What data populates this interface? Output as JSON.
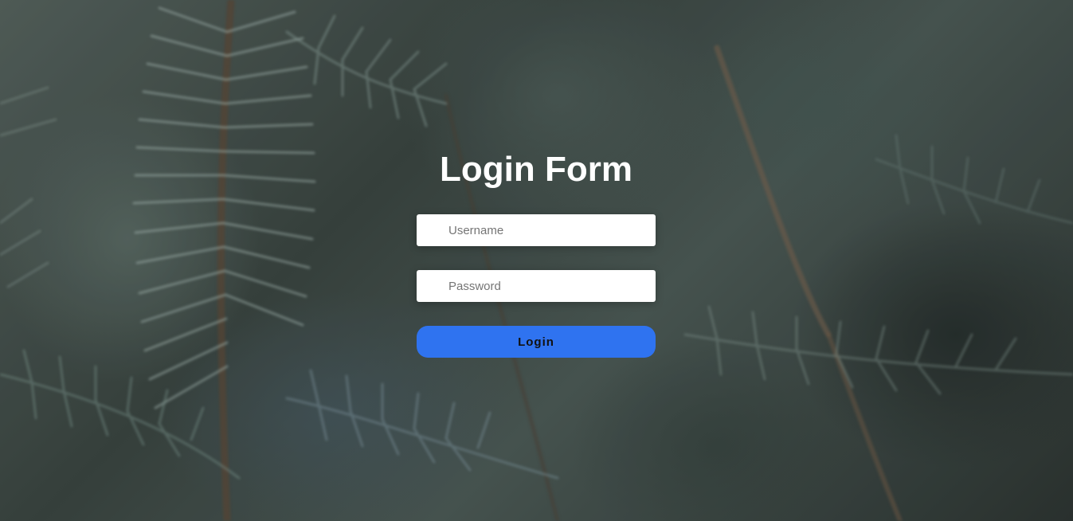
{
  "form": {
    "title": "Login Form",
    "username_placeholder": "Username",
    "password_placeholder": "Password",
    "username_value": "",
    "password_value": "",
    "login_label": "Login"
  },
  "colors": {
    "button": "#2f73f0",
    "title": "#ffffff",
    "field_background": "#ffffff"
  }
}
